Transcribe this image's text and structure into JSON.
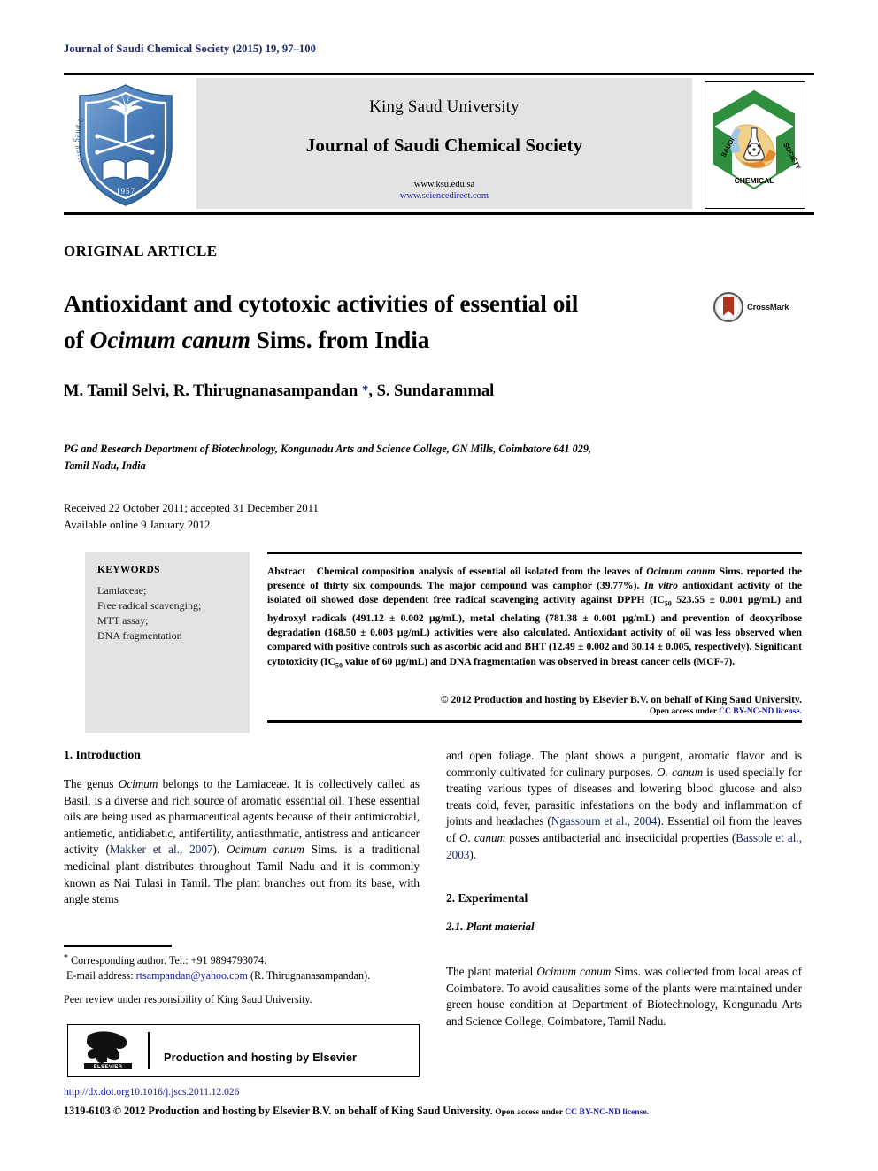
{
  "running_head": "Journal of Saudi Chemical Society (2015) 19, 97–100",
  "masthead": {
    "university": "King Saud University",
    "journal_name": "Journal of Saudi Chemical Society",
    "url_ksu": "www.ksu.edu.sa",
    "url_sciencedirect": "www.sciencedirect.com",
    "ksu_logo_alt": "king-saud-university-shield-logo",
    "ksu_logo_year": "1957",
    "scs_logo_alt": "saudi-chemical-society-hexagon-logo",
    "scs_logo_word_left": "SAUDI",
    "scs_logo_word_right": "SOCIETY",
    "scs_logo_word_bottom": "CHEMICAL"
  },
  "article": {
    "type_label": "ORIGINAL ARTICLE",
    "title_line1_a": "Antioxidant and cytotoxic activities of essential oil",
    "title_line2_a": "of ",
    "title_line2_italic": "Ocimum canum",
    "title_line2_b": " Sims. from India",
    "crossmark_label": "CrossMark",
    "authors": "M. Tamil Selvi, R. Thirugnanasampandan , S. Sundarammal",
    "authors_pre": "M. Tamil Selvi, R. Thirugnanasampandan ",
    "authors_post": ", S. Sundarammal",
    "corresponding_marker": "*",
    "affiliation_line1": "PG and Research Department of Biotechnology, Kongunadu Arts and Science College, GN Mills, Coimbatore 641 029,",
    "affiliation_line2": "Tamil Nadu, India",
    "received_line": "Received 22 October 2011; accepted 31 December 2011",
    "available_line": "Available online 9 January 2012"
  },
  "keywords": {
    "heading": "KEYWORDS",
    "items": [
      "Lamiaceae;",
      "Free radical scavenging;",
      "MTT assay;",
      "DNA fragmentation"
    ]
  },
  "abstract": {
    "label": "Abstract",
    "t1": "Chemical composition analysis of essential oil isolated from the leaves of ",
    "sp1": "Ocimum canum",
    "t2": " Sims. reported the presence of thirty six compounds. The major compound was camphor (39.77%). ",
    "it1": "In vitro",
    "t3": " antioxidant activity of the isolated oil showed dose dependent free radical scavenging activity against DPPH (IC",
    "sub1": "50",
    "t4": " 523.55 ± 0.001 µg/mL) and hydroxyl radicals (491.12 ± 0.002 µg/mL), metal chelating (781.38 ± 0.001 µg/mL) and prevention of deoxyribose degradation (168.50 ± 0.003 µg/mL) activities were also calculated. Antioxidant activity of oil was less observed when compared with positive controls such as ascorbic acid and BHT (12.49 ± 0.002 and 30.14 ± 0.005, respectively). Significant cytotoxicity (IC",
    "sub2": "50",
    "t5": " value of 60 µg/mL) and DNA fragmentation was observed in breast cancer cells (MCF-7).",
    "copyright": "© 2012 Production and hosting by Elsevier B.V. on behalf of King Saud University.",
    "open_access_pre": "Open access under ",
    "open_access_link": "CC BY-NC-ND license."
  },
  "body": {
    "left": {
      "section1_heading": "1. Introduction",
      "p1_a": "The genus ",
      "p1_it1": "Ocimum",
      "p1_b": " belongs to the Lamiaceae. It is collectively called as Basil, is a diverse and rich source of aromatic essential oil. These essential oils are being used as pharmaceutical agents because of their antimicrobial, antiemetic, antidiabetic, antifertility, antiasthmatic, antistress and anticancer activity (",
      "p1_cite1": "Makker et al., 2007",
      "p1_c": "). ",
      "p1_it2": "Ocimum canum",
      "p1_d": " Sims. is a traditional medicinal plant distributes throughout Tamil Nadu and it is commonly known as Nai Tulasi in Tamil. The plant branches out from its base, with angle stems"
    },
    "right": {
      "p1_a": "and open foliage. The plant shows a pungent, aromatic flavor and is commonly cultivated for culinary purposes. ",
      "p1_it1": "O. canum",
      "p1_b": " is used specially for treating various types of diseases and lowering blood glucose and also treats cold, fever, parasitic infestations on the body and inflammation of joints and headaches (",
      "p1_cite1": "Ngassoum et al., 2004",
      "p1_c": "). Essential oil from the leaves of ",
      "p1_it2": "O. canum",
      "p1_d": " posses antibacterial and insecticidal properties (",
      "p1_cite2": "Bassole et al., 2003",
      "p1_e": ").",
      "section2_heading": "2. Experimental",
      "subsection21_heading": "2.1. Plant material",
      "p2_a": "The plant material ",
      "p2_it1": "Ocimum canum",
      "p2_b": " Sims. was collected from local areas of Coimbatore. To avoid causalities some of the plants were maintained under green house condition at Department of Biotechnology, Kongunadu Arts and Science College, Coimbatore, Tamil Nadu."
    }
  },
  "footnotes": {
    "corresponding_marker": "*",
    "corresponding": " Corresponding author. Tel.: +91 9894793074.",
    "email_label": "E-mail address: ",
    "email": "rtsampandan@yahoo.com",
    "email_suffix": " (R. Thirugnanasampandan).",
    "peer_review": "Peer review under responsibility of King Saud University."
  },
  "elsevier_box": {
    "logo_word": "ELSEVIER",
    "text": "Production and hosting by Elsevier"
  },
  "footer": {
    "doi": "http://dx.doi.org10.1016/j.jscs.2011.12.026",
    "issn_line": "1319-6103 © 2012 Production and hosting by Elsevier B.V. on behalf of King Saud University.",
    "open_access_pre": " Open access under ",
    "open_access_link": "CC BY-NC-ND license."
  },
  "colors": {
    "link_blue": "#1a1aa8",
    "cite_blue": "#1a2a6c",
    "panel_gray": "#e3e3e3",
    "crossmark_red": "#b0331f",
    "logo_blue": "#4a7ebb",
    "scs_green": "#2f8f3f"
  }
}
